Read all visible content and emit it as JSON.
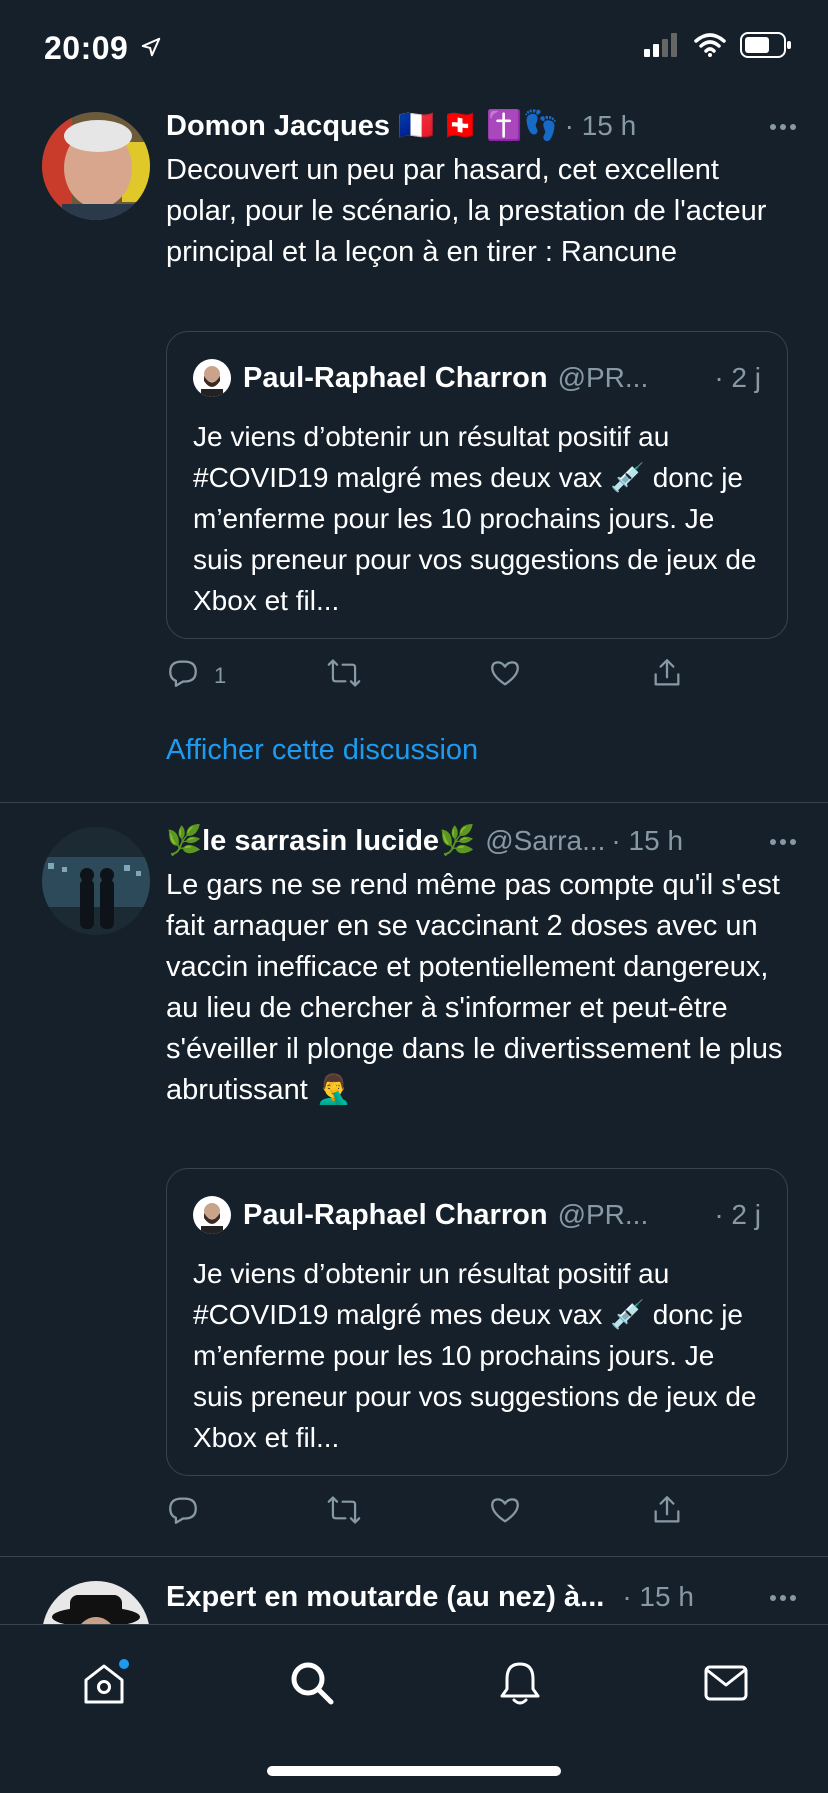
{
  "status_bar": {
    "time": "20:09"
  },
  "tweets": [
    {
      "author": "Domon Jacques 🇫🇷 🇨🇭 ✝️👣",
      "handle": "",
      "time": "· 15 h",
      "text": "Decouvert un peu par hasard, cet excellent polar, pour le scénario,  la prestation de l'acteur principal et la leçon à en tirer : Rancune",
      "quote": {
        "author": "Paul-Raphael Charron",
        "handle": "@PR...",
        "time": "· 2 j",
        "text": "Je viens d’obtenir un résultat positif au #COVID19 malgré mes deux vax 💉 donc je m’enferme pour les 10 prochains jours. Je suis preneur pour vos suggestions de jeux de Xbox et fil..."
      },
      "reply_count": "1",
      "show_thread": "Afficher cette discussion"
    },
    {
      "author": "🌿le sarrasin lucide🌿",
      "handle": "@Sarra...",
      "time": "· 15 h",
      "text": "Le gars ne se rend même pas compte qu'il s'est fait arnaquer en se vaccinant 2 doses avec un vaccin inefficace et potentiellement dangereux, au lieu de chercher à s'informer et peut-être s'éveiller il plonge dans le divertissement le plus abrutissant 🤦‍♂️",
      "quote": {
        "author": "Paul-Raphael Charron",
        "handle": "@PR...",
        "time": "· 2 j",
        "text": "Je viens d’obtenir un résultat positif au #COVID19 malgré mes deux vax 💉 donc je m’enferme pour les 10 prochains jours. Je suis preneur pour vos suggestions de jeux de Xbox et fil..."
      }
    },
    {
      "author": "Expert en moutarde (au nez) à...",
      "time": "· 15 h"
    }
  ],
  "icons": {
    "reply": "reply-icon",
    "retweet": "retweet-icon",
    "like": "like-icon",
    "share": "share-icon",
    "more": "more-icon",
    "home": "home-icon",
    "search": "search-icon",
    "notifications": "bell-icon",
    "messages": "mail-icon"
  },
  "colors": {
    "background": "#15202b",
    "accent": "#1d9bf0",
    "secondary_text": "#8899a6",
    "border": "#38444d"
  }
}
